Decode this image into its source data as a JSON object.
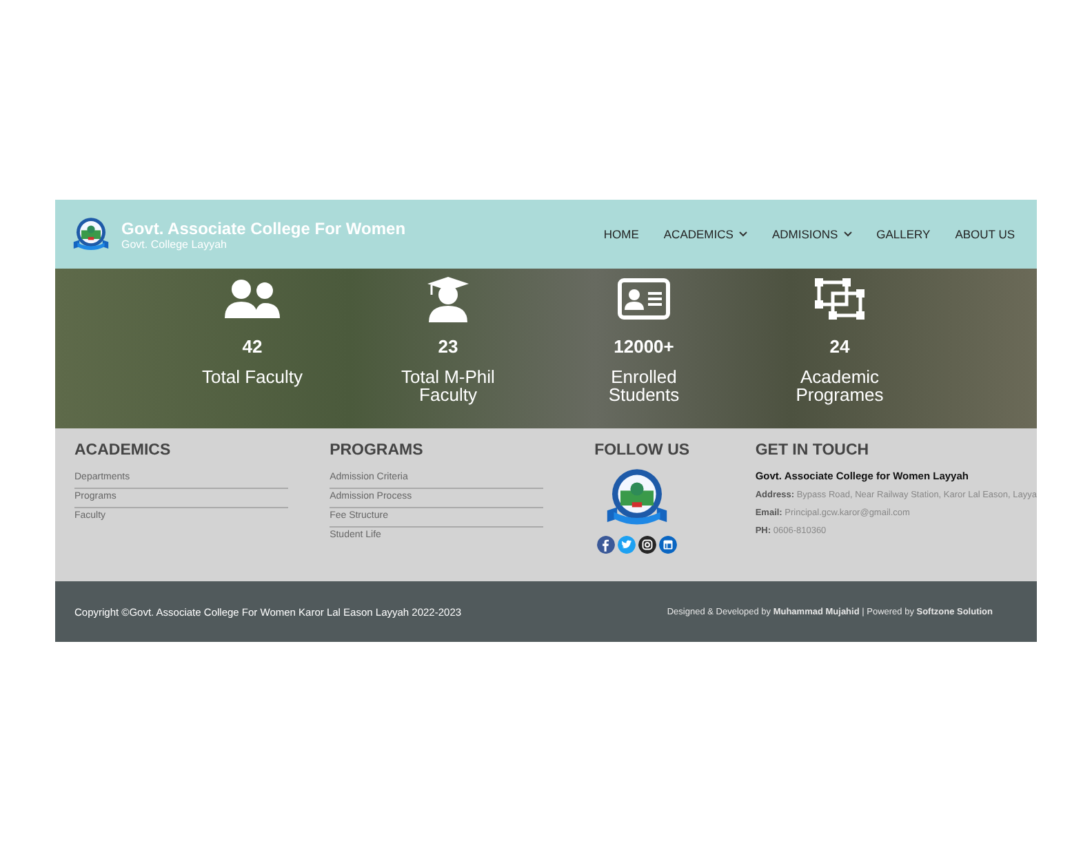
{
  "header": {
    "title": "Govt. Associate College For Women",
    "subtitle": "Govt. College Layyah",
    "nav": [
      {
        "label": "HOME",
        "has_dropdown": false
      },
      {
        "label": "ACADEMICS",
        "has_dropdown": true
      },
      {
        "label": "ADMISIONS",
        "has_dropdown": true
      },
      {
        "label": "GALLERY",
        "has_dropdown": false
      },
      {
        "label": "ABOUT US",
        "has_dropdown": false
      }
    ]
  },
  "stats": [
    {
      "kind": "users",
      "value": "42",
      "label": "Total Faculty"
    },
    {
      "kind": "graduate",
      "value": "23",
      "label": "Total M-Phil Faculty"
    },
    {
      "kind": "id-card",
      "value": "12000+",
      "label": "Enrolled Students"
    },
    {
      "kind": "frames",
      "value": "24",
      "label": "Academic Programes"
    }
  ],
  "footer": {
    "academics": {
      "title": "ACADEMICS",
      "links": [
        "Departments",
        "Programs",
        "Faculty"
      ]
    },
    "programs": {
      "title": "PROGRAMS",
      "links": [
        "Admission Criteria",
        "Admission Process",
        "Fee Structure",
        "Student Life"
      ]
    },
    "follow": {
      "title": "FOLLOW US",
      "social": [
        {
          "kind": "facebook",
          "color": "#3b5998"
        },
        {
          "kind": "twitter",
          "color": "#1da1f2"
        },
        {
          "kind": "instagram",
          "color": "#262626"
        },
        {
          "kind": "linkedin",
          "color": "#0a66c2"
        }
      ]
    },
    "contact": {
      "title": "GET IN TOUCH",
      "name": "Govt. Associate College for Women Layyah",
      "lines": [
        {
          "label": "Address:",
          "value": "Bypass Road, Near Railway Station, Karor Lal Eason, Layya"
        },
        {
          "label": "Email:",
          "value": "Principal.gcw.karor@gmail.com"
        },
        {
          "label": "PH:",
          "value": "0606-810360"
        }
      ]
    }
  },
  "bottom": {
    "copyright": "Copyright ©Govt. Associate College For Women Karor Lal Eason Layyah 2022-2023",
    "credits": "Designed & Developed  by **Muhammad Mujahid** | Powered by **Softzone Solution**"
  }
}
